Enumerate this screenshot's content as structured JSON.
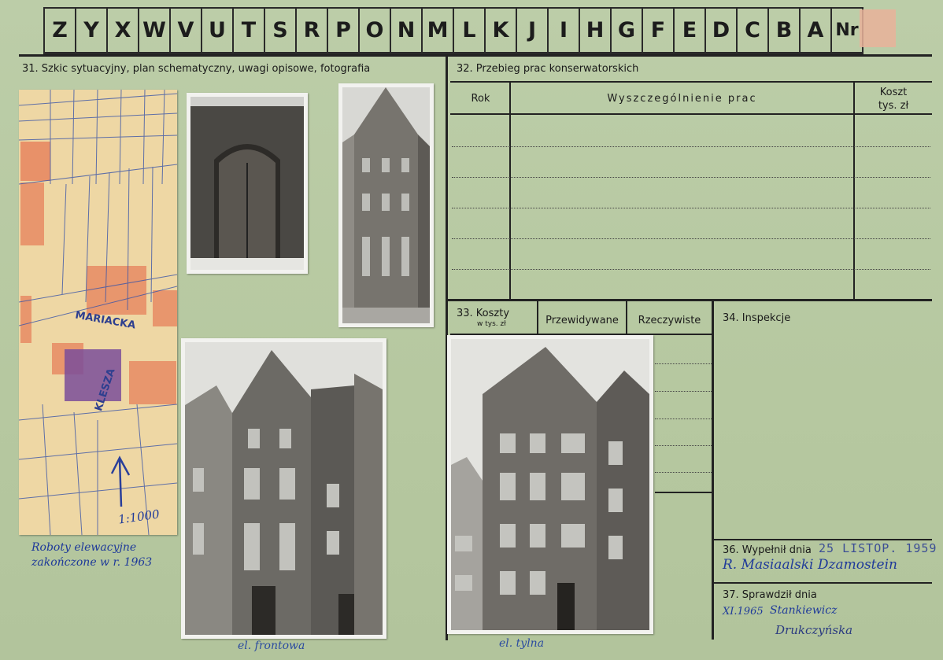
{
  "header": {
    "letters": [
      "Z",
      "Y",
      "X",
      "W",
      "V",
      "U",
      "T",
      "S",
      "R",
      "P",
      "O",
      "N",
      "M",
      "L",
      "K",
      "J",
      "I",
      "H",
      "G",
      "F",
      "E",
      "D",
      "C",
      "B",
      "A"
    ],
    "nr_label": "Nr"
  },
  "section31": {
    "title": "31. Szkic sytuacyjny, plan schematyczny, uwagi opisowe, fotografia",
    "map": {
      "street1": "MARIACKA",
      "street2": "KLESZA",
      "scale": "1:1000"
    },
    "note_line1": "Roboty elewacyjne",
    "note_line2": "zakończone w r. 1963",
    "caption_left": "el. frontowa",
    "caption_right": "el. tylna"
  },
  "section32": {
    "title": "32. Przebieg prac konserwatorskich",
    "col_year": "Rok",
    "col_details": "Wyszczególnienie prac",
    "col_cost": "Koszt",
    "col_cost_unit": "tys. zł"
  },
  "section33": {
    "title": "33. Koszty",
    "title_unit": "w tys. zł",
    "col_planned": "Przewidywane",
    "col_actual": "Rzeczywiste"
  },
  "section34": {
    "title": "34. Inspekcje"
  },
  "section36": {
    "label": "36. Wypełnił dnia",
    "date_stamp": "25 LISTOP. 1959",
    "signature": "R. Masiaalski  Dzamostein"
  },
  "section37": {
    "label": "37. Sprawdził dnia",
    "date": "XI.1965",
    "signature1": "Stankiewicz",
    "signature2": "Drukczyńska"
  },
  "colors": {
    "card": "#b8c9a2",
    "ink": "#222222",
    "handwriting": "#1f3a9a",
    "stamp": "#3c4e95"
  }
}
